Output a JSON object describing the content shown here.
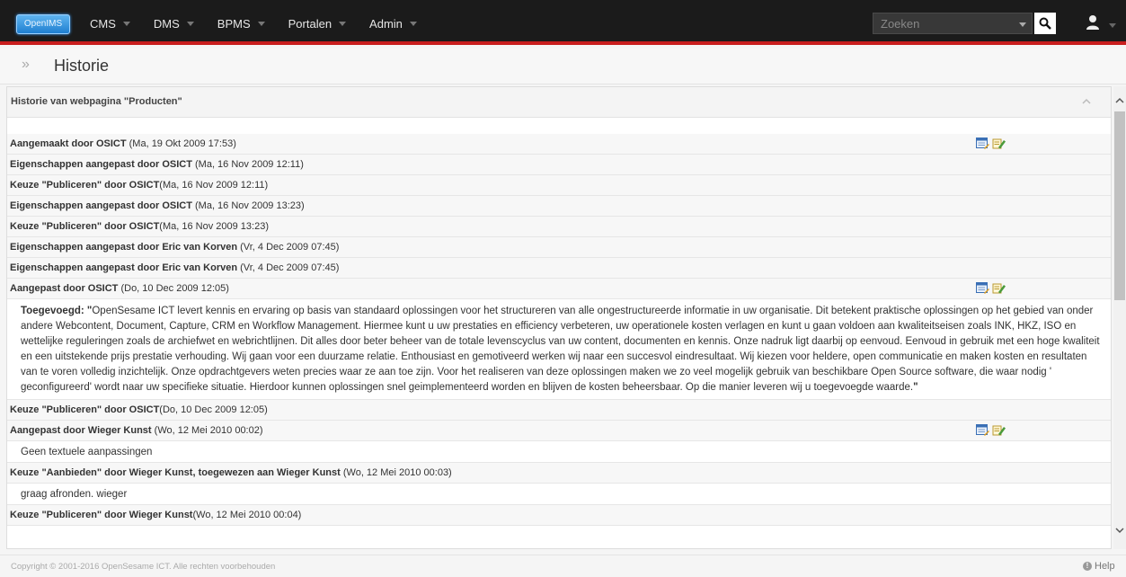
{
  "nav": {
    "logo": "OpenIMS",
    "items": [
      {
        "label": "CMS"
      },
      {
        "label": "DMS"
      },
      {
        "label": "BPMS"
      },
      {
        "label": "Portalen"
      },
      {
        "label": "Admin"
      }
    ],
    "search_placeholder": "Zoeken"
  },
  "page": {
    "title": "Historie"
  },
  "panel": {
    "title": "Historie van webpagina \"Producten\"",
    "rows": [
      {
        "actor": "Aangemaakt door OSICT",
        "meta": " (Ma, 19 Okt 2009 17:53)",
        "has_icons": true
      },
      {
        "actor": "Eigenschappen aangepast door OSICT",
        "meta": " (Ma, 16 Nov 2009 12:11)"
      },
      {
        "actor": "Keuze \"Publiceren\" door OSICT",
        "meta": "(Ma, 16 Nov 2009 12:11)"
      },
      {
        "actor": "Eigenschappen aangepast door OSICT",
        "meta": " (Ma, 16 Nov 2009 13:23)"
      },
      {
        "actor": "Keuze \"Publiceren\" door OSICT",
        "meta": "(Ma, 16 Nov 2009 13:23)"
      },
      {
        "actor": "Eigenschappen aangepast door Eric van Korven",
        "meta": " (Vr, 4 Dec 2009 07:45)"
      },
      {
        "actor": "Eigenschappen aangepast door Eric van Korven",
        "meta": " (Vr, 4 Dec 2009 07:45)"
      },
      {
        "actor": "Aangepast door OSICT",
        "meta": " (Do, 10 Dec 2009 12:05)",
        "has_icons": true,
        "detail_label": "Toegevoegd: ",
        "detail_text": "OpenSesame ICT levert kennis en ervaring op basis van standaard oplossingen voor het structureren van alle ongestructureerde informatie in uw organisatie.  Dit betekent praktische oplossingen op het gebied van onder andere Webcontent,  Document,  Capture,  CRM en Workflow Management.  Hiermee kunt u uw  prestaties en efficiency verbeteren,  uw operationele kosten verlagen en kunt u gaan voldoen aan kwaliteitseisen zoals INK,  HKZ,  ISO en wettelijke reguleringen zoals de archiefwet en webrichtlijnen.  Dit alles door  beter beheer van de totale levenscyclus van uw content,  documenten en kennis.  Onze nadruk ligt daarbij op eenvoud.  Eenvoud in gebruik met een hoge kwaliteit en een uitstekende prijs prestatie verhouding.  Wij gaan voor een duurzame relatie.  Enthousiast en gemotiveerd werken wij naar een succesvol eindresultaat.  Wij kiezen voor heldere,  open communicatie en maken kosten en resultaten van te voren volledig inzichtelijk.  Onze opdrachtgevers weten precies waar ze aan toe zijn.  Voor het realiseren van deze oplossingen maken we zo veel mogelijk gebruik van beschikbare Open Source software,  die waar nodig ' geconfigureerd' wordt naar uw specifieke situatie.  Hierdoor kunnen oplossingen snel geimplementeerd worden en blijven de kosten beheersbaar.  Op die manier leveren wij u toegevoegde waarde."
      },
      {
        "actor": "Keuze \"Publiceren\" door OSICT",
        "meta": "(Do, 10 Dec 2009 12:05)"
      },
      {
        "actor": "Aangepast door Wieger Kunst",
        "meta": " (Wo, 12 Mei 2010 00:02)",
        "has_icons": true,
        "detail_text": "Geen textuele aanpassingen"
      },
      {
        "actor": "Keuze \"Aanbieden\" door Wieger Kunst, toegewezen aan Wieger Kunst",
        "meta": " (Wo, 12 Mei 2010 00:03)",
        "detail_text": "graag afronden. wieger"
      },
      {
        "actor": "Keuze \"Publiceren\" door Wieger Kunst",
        "meta": "(Wo, 12 Mei 2010 00:04)"
      }
    ]
  },
  "footer": {
    "copyright": "Copyright © 2001-2016 OpenSesame ICT. Alle rechten voorbehouden",
    "help": "Help"
  },
  "colors": {
    "accent": "#c81e1e",
    "topbar": "#1b1b1b"
  }
}
